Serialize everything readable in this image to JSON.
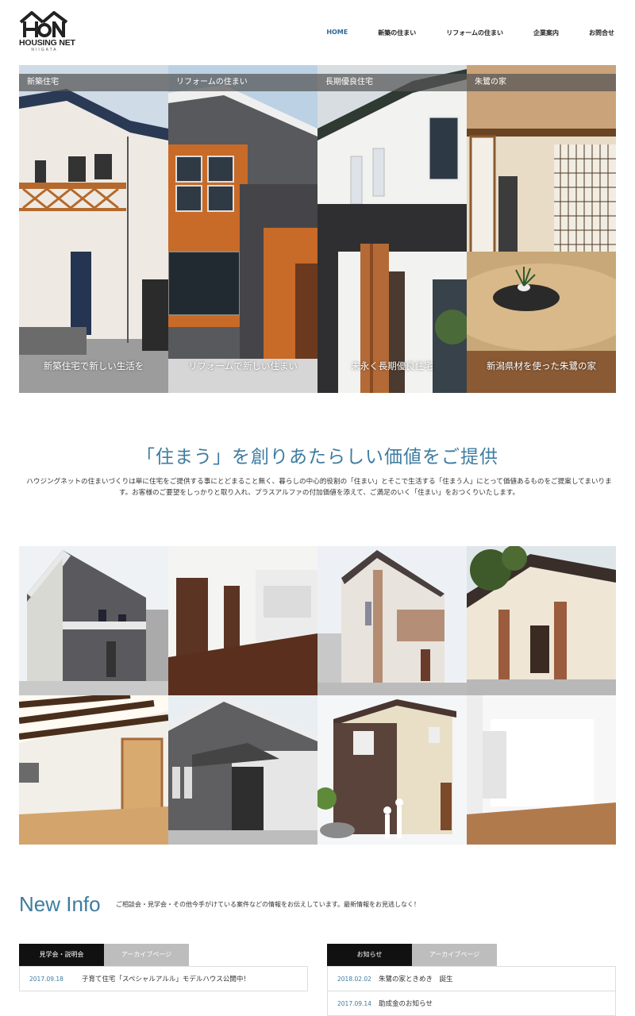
{
  "brand": {
    "logo_text": "HOUSING NET",
    "logo_sub": "NIIGATA"
  },
  "nav": [
    {
      "label": "HOME",
      "active": true
    },
    {
      "label": "新築の住まい"
    },
    {
      "label": "リフォームの住まい"
    },
    {
      "label": "企業案内"
    },
    {
      "label": "お問合せ"
    }
  ],
  "hero": [
    {
      "caption": "新築住宅",
      "footer": "新築住宅で新しい生活を"
    },
    {
      "caption": "リフォームの住まい",
      "footer": "リフォームで新しい住まい"
    },
    {
      "caption": "長期優良住宅",
      "footer": "末永く長期優良住宅"
    },
    {
      "caption": "朱鷺の家",
      "footer": "新潟県材を使った朱鷺の家"
    }
  ],
  "intro": {
    "headline": "「住まう」を創りあたらしい価値をご提供",
    "text": "ハウジングネットの住まいづくりは単に住宅をご提供する事にとどまること無く、暮らしの中心的役割の「住まい」とそこで生活する「住まう人」にとって価値あるものをご提案してまいります。お客様のご要望をしっかりと取り入れ、プラスアルファの付加価値を添えて、ご満足のいく「住まい」をおつくりいたします。"
  },
  "new_info": {
    "title": "New Info",
    "description": "ご相談会・見学会・その他今手がけている案件などの情報をお伝えしています。最新情報をお見逃しなく！"
  },
  "events": {
    "tab_main": "見学会・説明会",
    "tab_archive": "アーカイブページ",
    "items": [
      {
        "date": "2017.09.18",
        "title": "子育て住宅「スペシャルアルル」モデルハウス公開中！"
      }
    ]
  },
  "notices": {
    "tab_main": "お知らせ",
    "tab_archive": "アーカイブページ",
    "items": [
      {
        "date": "2018.02.02",
        "title": "朱鷺の家ときめき　誕生"
      },
      {
        "date": "2017.09.14",
        "title": "助成金のお知らせ"
      }
    ]
  },
  "colors": {
    "accent": "#3e7ca0",
    "dark_tab": "#111111",
    "gray_tab": "#bdbdbd"
  }
}
